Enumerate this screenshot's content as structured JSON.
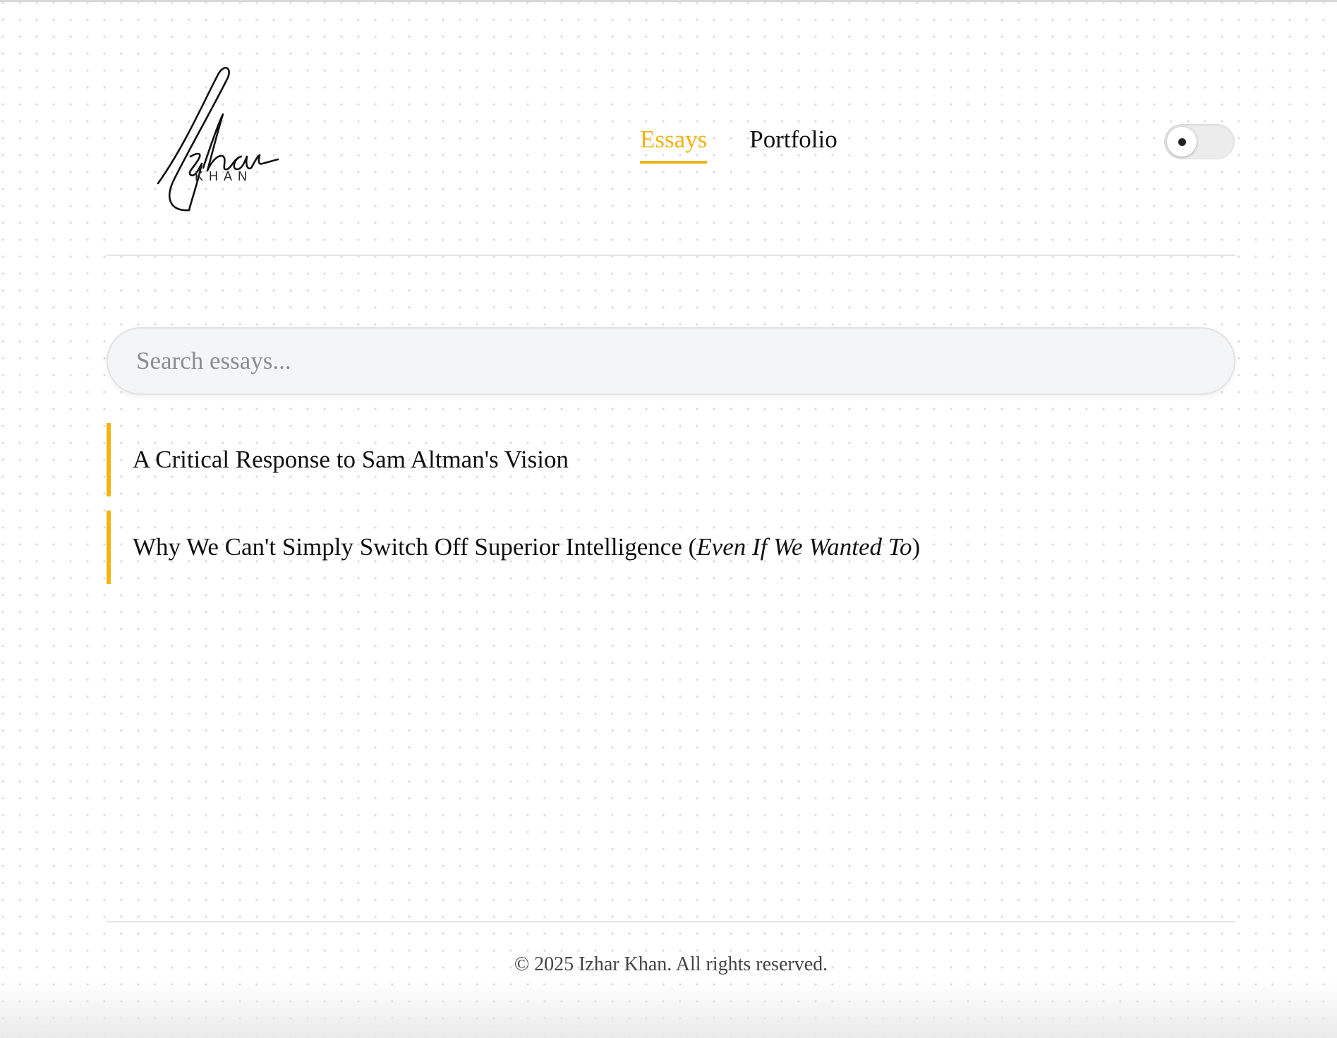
{
  "logo": {
    "signature_text": "Izhar",
    "subtitle": "KHAN"
  },
  "nav": {
    "items": [
      {
        "label": "Essays",
        "active": true
      },
      {
        "label": "Portfolio",
        "active": false
      }
    ]
  },
  "theme_toggle": {
    "state": "off",
    "icon": "dot-icon"
  },
  "search": {
    "placeholder": "Search essays...",
    "value": ""
  },
  "essays": [
    {
      "title": "A Critical Response to Sam Altman's Vision"
    },
    {
      "title_main": "Why We Can't Simply Switch Off Superior Intelligence (",
      "title_italic": "Even If We Wanted To",
      "title_end": ")"
    }
  ],
  "footer": {
    "copyright": "© 2025 Izhar Khan. All rights reserved."
  },
  "colors": {
    "accent": "#f2b20f",
    "text": "#111111",
    "search_bg": "#f4f5f7"
  }
}
